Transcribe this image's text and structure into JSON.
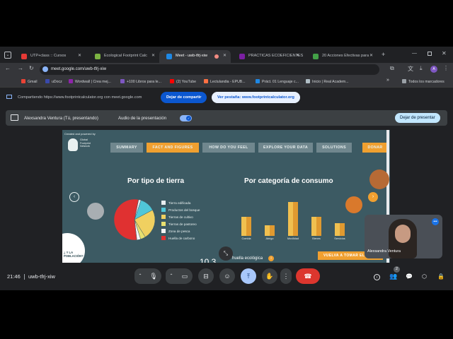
{
  "tabs": [
    {
      "label": "UTP+class :: Cursos",
      "color": "#e53935"
    },
    {
      "label": "Ecological Footprint Calc",
      "color": "#7cb342"
    },
    {
      "label": "Meet - uwb-tfrj-xiw",
      "color": "#1e88e5"
    },
    {
      "label": "PRACTICAS ECOEFICIENTES",
      "color": "#7b1fa2"
    },
    {
      "label": "20 Acciones Efectivas para",
      "color": "#43a047"
    }
  ],
  "url": "meet.google.com/uwb-tfrj-xiw",
  "bookmarks": [
    {
      "label": "Gmail",
      "color": "#ea4335"
    },
    {
      "label": "uDocz",
      "color": "#3949ab"
    },
    {
      "label": "Wordwall | Crea mej...",
      "color": "#8e24aa"
    },
    {
      "label": "+100 Libros para le...",
      "color": "#7e57c2"
    },
    {
      "label": "(2) YouTube",
      "color": "#ff0000"
    },
    {
      "label": "Lectulandia - EPUB...",
      "color": "#ff7043"
    },
    {
      "label": "Práct. 01 Lenguaje c...",
      "color": "#1e88e5"
    },
    {
      "label": "Inicio | Real Academ...",
      "color": "#b0bec5"
    },
    {
      "label": "Todos los marcadores",
      "color": "#9aa0a6"
    }
  ],
  "share": {
    "text": "Compartiendo https://www.footprintcalculator.org con meet.google.com",
    "stop_label": "Dejar de compartir",
    "tab_label": "Ver pestaña: www.footprintcalculator.org"
  },
  "presenting": {
    "name": "Alexsandra Ventura (Tú, presentando)",
    "audio_label": "Audio de la presentación",
    "stop_label": "Dejar de presentar"
  },
  "slide": {
    "powered": "Created and powered by",
    "logo_text": "Global Footprint Network",
    "nav": [
      "SUMMARY",
      "FACT AND FIGURES",
      "HOW DO YOU FEEL",
      "EXPLORE YOUR DATA",
      "SOLUTIONS",
      "DONAR"
    ],
    "nav_active": "#f0a030",
    "left_title": "Por tipo de tierra",
    "right_title": "Por categoría de consumo",
    "legend": [
      {
        "label": "Tierra edificada",
        "color": "#e8eef0"
      },
      {
        "label": "Productos del bosque",
        "color": "#50c7d8"
      },
      {
        "label": "Tierras de cultivo",
        "color": "#f0d060"
      },
      {
        "label": "Tierras de pastoreo",
        "color": "#e8e070"
      },
      {
        "label": "Zona de pesca",
        "color": "#f4f4f4"
      },
      {
        "label": "Huella de carbono",
        "color": "#e03131"
      }
    ],
    "bars": [
      "Comida",
      "Abrigo",
      "Movilidad",
      "Bienes",
      "Servicios"
    ],
    "poblacion": "¿ Y LA POBLACIÓN?",
    "bottom_text": "huella ecológica",
    "bottom_number": "10.3",
    "cta": "VUELVA A TOMAR EL"
  },
  "pie_values": [
    {
      "label": "Tierra edificada",
      "value": 2,
      "color": "#e8eef0"
    },
    {
      "label": "Productos del bosque",
      "value": 12,
      "color": "#50c7d8"
    },
    {
      "label": "Tierras de cultivo",
      "value": 24,
      "color": "#f0d060"
    },
    {
      "label": "Tierras de pastoreo",
      "value": 4,
      "color": "#e8e070"
    },
    {
      "label": "Zona de pesca",
      "value": 3,
      "color": "#f4f4f4"
    },
    {
      "label": "Huella de carbono",
      "value": 55,
      "color": "#e03131"
    }
  ],
  "bar_levels": [
    0.45,
    0.25,
    0.8,
    0.45,
    0.3
  ],
  "participant": {
    "name": "Alexsandra Ventura"
  },
  "bottombar": {
    "time": "21:46",
    "meeting": "uwb-tfrj-xiw",
    "people_count": "2"
  }
}
